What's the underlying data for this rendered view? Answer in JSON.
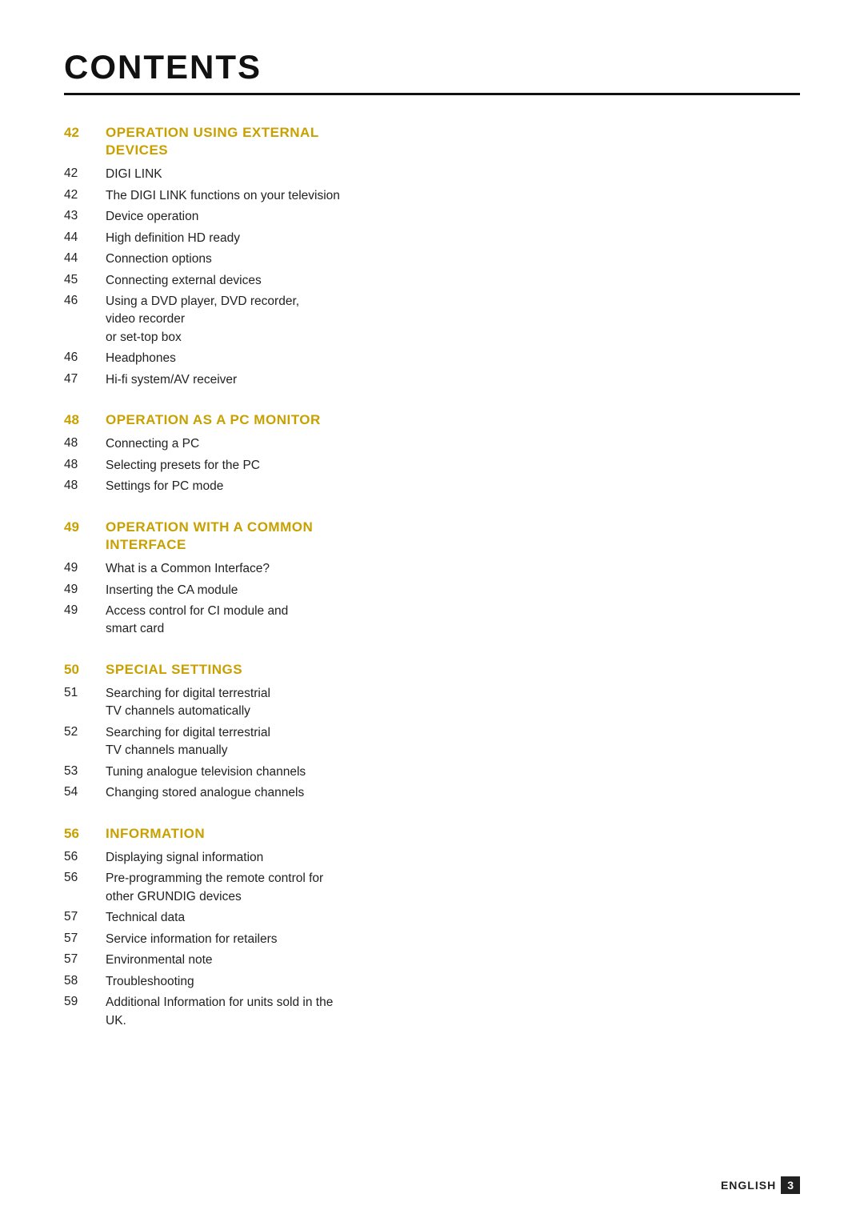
{
  "page": {
    "title": "CONTENTS",
    "footer": {
      "language": "ENGLISH",
      "page_number": "3"
    }
  },
  "sections": [
    {
      "id": "section-external-devices",
      "number": "42",
      "title": "OPERATION USING EXTERNAL\nDEVICES",
      "entries": [
        {
          "number": "42",
          "text": "DIGI LINK"
        },
        {
          "number": "42",
          "text": "The DIGI LINK functions on your television"
        },
        {
          "number": "43",
          "text": "Device operation"
        },
        {
          "number": "44",
          "text": "High definition  HD ready"
        },
        {
          "number": "44",
          "text": "Connection options"
        },
        {
          "number": "45",
          "text": "Connecting external devices"
        },
        {
          "number": "46",
          "text": "Using a DVD player, DVD recorder,\nvideo recorder\nor set-top box"
        },
        {
          "number": "46",
          "text": "Headphones"
        },
        {
          "number": "47",
          "text": "Hi-fi system/AV receiver"
        }
      ]
    },
    {
      "id": "section-pc-monitor",
      "number": "48",
      "title": "OPERATION AS A PC MONITOR",
      "entries": [
        {
          "number": "48",
          "text": "Connecting a PC"
        },
        {
          "number": "48",
          "text": "Selecting presets for the PC"
        },
        {
          "number": "48",
          "text": "Settings for PC mode"
        }
      ]
    },
    {
      "id": "section-common-interface",
      "number": "49",
      "title": "OPERATION WITH A COMMON\nINTERFACE",
      "entries": [
        {
          "number": "49",
          "text": "What is a Common Interface?"
        },
        {
          "number": "49",
          "text": "Inserting the CA module"
        },
        {
          "number": "49",
          "text": "Access control for CI module and\nsmart card"
        }
      ]
    },
    {
      "id": "section-special-settings",
      "number": "50",
      "title": "SPECIAL SETTINGS",
      "entries": [
        {
          "number": "51",
          "text": "Searching for digital terrestrial\nTV channels automatically"
        },
        {
          "number": "52",
          "text": "Searching for digital terrestrial\nTV channels manually"
        },
        {
          "number": "53",
          "text": "Tuning analogue television channels"
        },
        {
          "number": "54",
          "text": "Changing stored analogue channels"
        }
      ]
    },
    {
      "id": "section-information",
      "number": "56",
      "title": "INFORMATION",
      "entries": [
        {
          "number": "56",
          "text": "Displaying signal information"
        },
        {
          "number": "56",
          "text": "Pre-programming the remote control for\nother GRUNDIG devices"
        },
        {
          "number": "57",
          "text": "Technical data"
        },
        {
          "number": "57",
          "text": "Service information for retailers"
        },
        {
          "number": "57",
          "text": "Environmental note"
        },
        {
          "number": "58",
          "text": "Troubleshooting"
        },
        {
          "number": "59",
          "text": "Additional Information for units sold in the\nUK."
        }
      ]
    }
  ]
}
